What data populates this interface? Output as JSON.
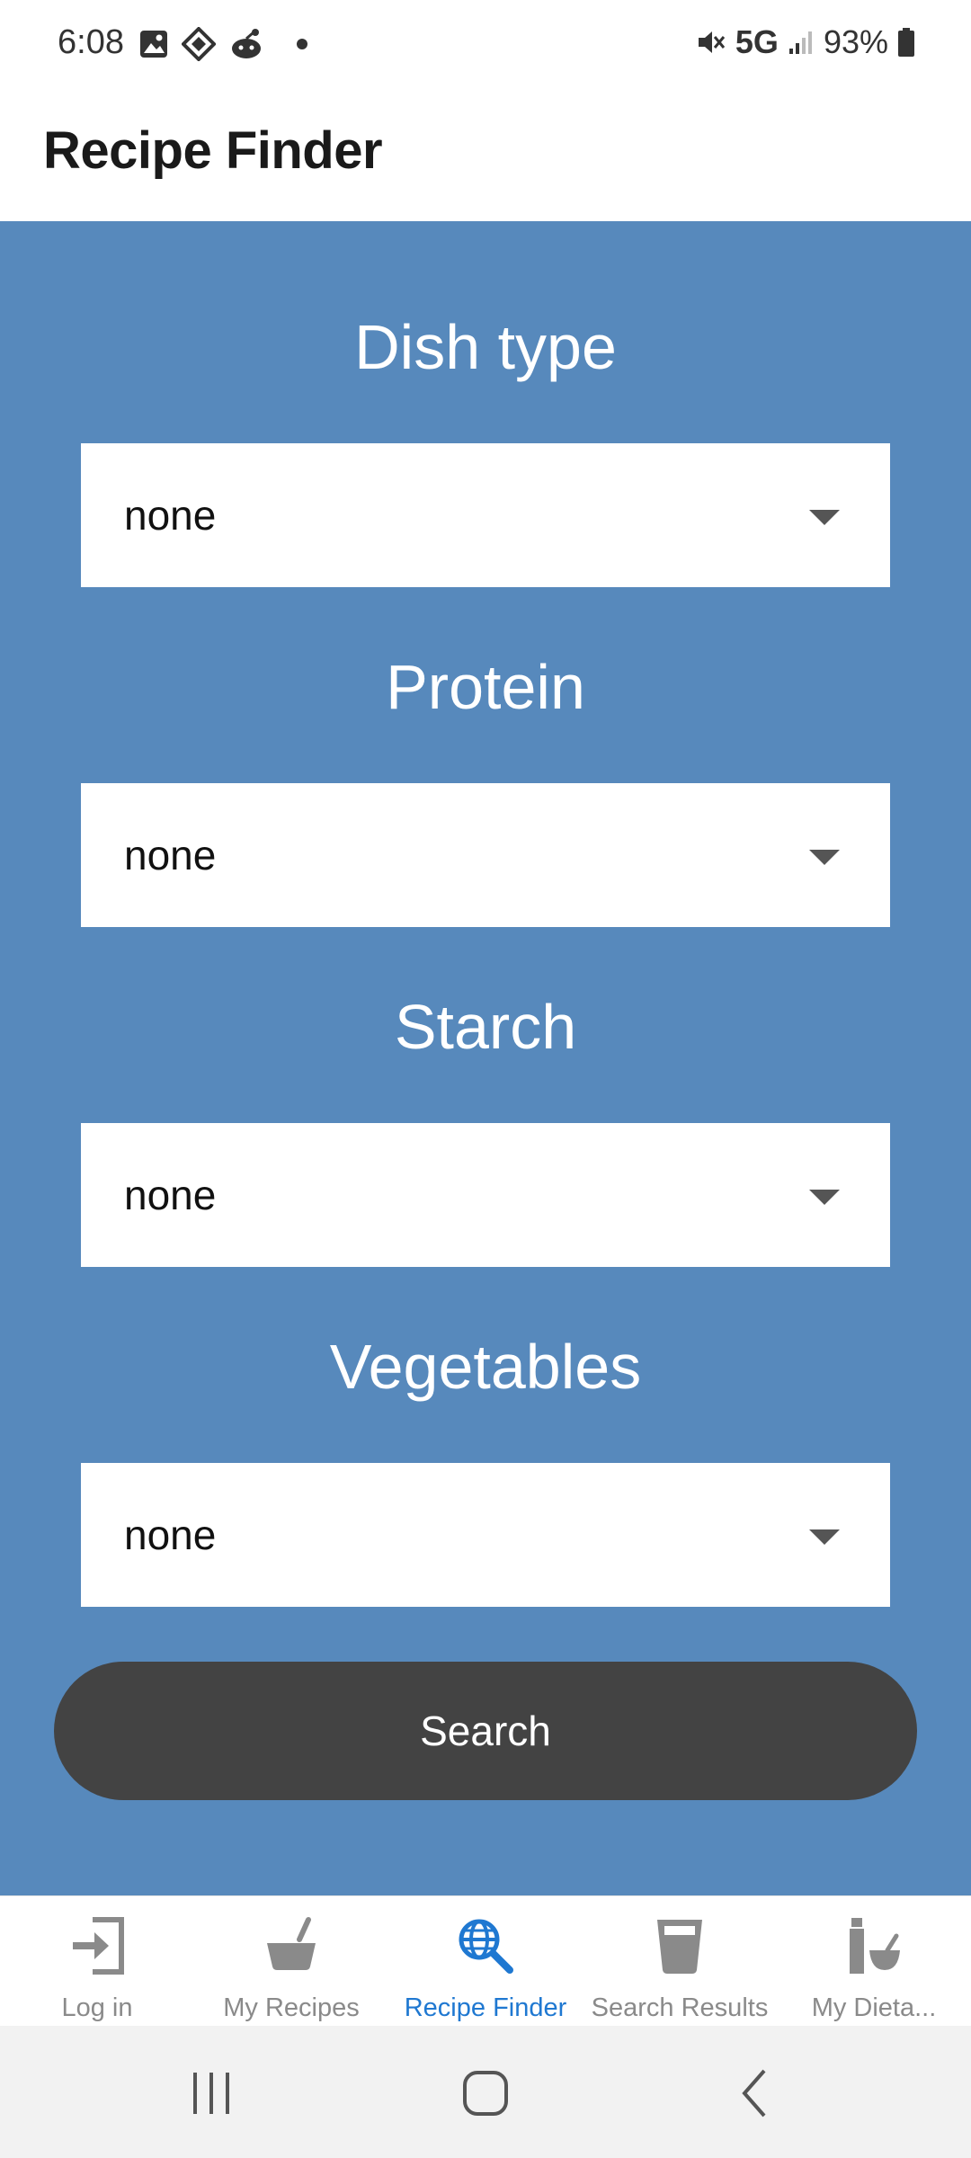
{
  "status_bar": {
    "time": "6:08",
    "network": "5G",
    "battery": "93%",
    "icons": [
      "image-icon",
      "app-icon",
      "reddit-icon",
      "dot-icon",
      "mute-icon",
      "signal-icon",
      "battery-icon"
    ]
  },
  "app_bar": {
    "title": "Recipe Finder"
  },
  "form": {
    "dish_type": {
      "label": "Dish type",
      "value": "none"
    },
    "protein": {
      "label": "Protein",
      "value": "none"
    },
    "starch": {
      "label": "Starch",
      "value": "none"
    },
    "vegetables": {
      "label": "Vegetables",
      "value": "none"
    },
    "search_label": "Search"
  },
  "bottom_nav": {
    "items": [
      {
        "label": "Log in",
        "icon": "login-icon",
        "active": false
      },
      {
        "label": "My Recipes",
        "icon": "pot-icon",
        "active": false
      },
      {
        "label": "Recipe Finder",
        "icon": "globe-search-icon",
        "active": true
      },
      {
        "label": "Search Results",
        "icon": "cup-icon",
        "active": false
      },
      {
        "label": "My Dieta...",
        "icon": "bottle-bowl-icon",
        "active": false
      }
    ]
  },
  "colors": {
    "main_bg": "#5789bc",
    "button_bg": "#434343",
    "active_nav": "#1f78d1",
    "inactive_nav": "#8a8a8a"
  }
}
